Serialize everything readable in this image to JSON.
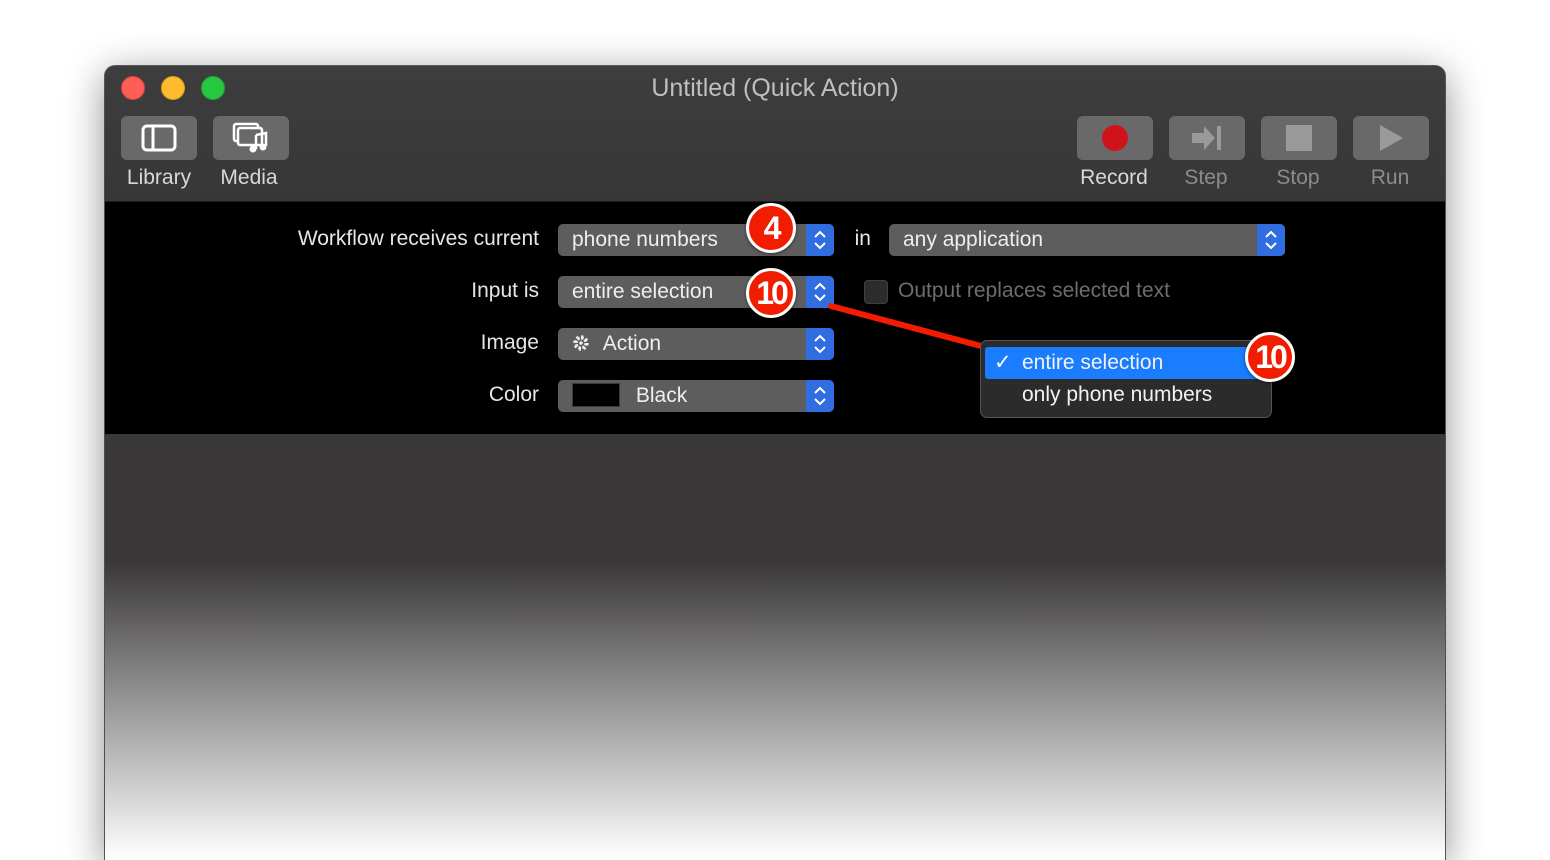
{
  "window": {
    "title": "Untitled (Quick Action)"
  },
  "toolbar": {
    "library_label": "Library",
    "media_label": "Media",
    "record_label": "Record",
    "step_label": "Step",
    "stop_label": "Stop",
    "run_label": "Run"
  },
  "workflow": {
    "receives_label": "Workflow receives current",
    "receives_value": "phone numbers",
    "in_label": "in",
    "application_value": "any application",
    "input_label": "Input is",
    "input_value": "entire selection",
    "output_checkbox_label": "Output replaces selected text",
    "output_checked": false,
    "image_label": "Image",
    "image_value": "Action",
    "color_label": "Color",
    "color_value": "Black"
  },
  "input_menu": {
    "items": [
      {
        "label": "entire selection",
        "selected": true
      },
      {
        "label": "only phone numbers",
        "selected": false
      }
    ]
  },
  "callouts": {
    "badge_receives": "4",
    "badge_input": "10",
    "badge_menu": "10"
  },
  "colors": {
    "accent": "#1a7cff",
    "callout": "#f21d00",
    "record": "#d0121b"
  }
}
